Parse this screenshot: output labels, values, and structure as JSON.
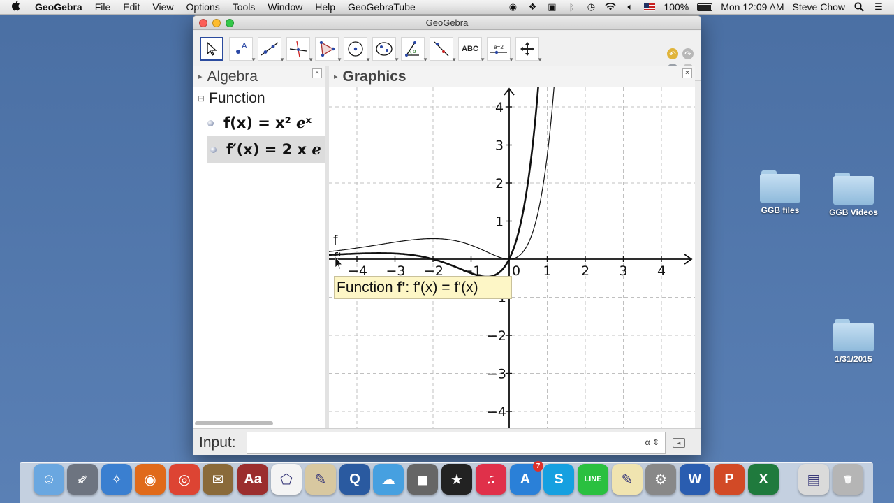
{
  "menubar": {
    "apple": "",
    "app_name": "GeoGebra",
    "items": [
      "File",
      "Edit",
      "View",
      "Options",
      "Tools",
      "Window",
      "Help",
      "GeoGebraTube"
    ],
    "battery": "100%",
    "clock": "Mon 12:09 AM",
    "user": "Steve Chow"
  },
  "window": {
    "title": "GeoGebra"
  },
  "toolbar": {
    "tools": [
      "move-tool",
      "point-tool",
      "line-tool",
      "perpendicular-tool",
      "polygon-tool",
      "circle-tool",
      "conic-tool",
      "angle-tool",
      "reflect-tool",
      "text-tool",
      "slider-tool",
      "move-graphics-tool"
    ],
    "text_tool_label": "ABC",
    "slider_tool_label": "a=2"
  },
  "algebra": {
    "title": "Algebra",
    "group": "Function",
    "items": [
      {
        "label": "f(x) = x² ℯˣ"
      },
      {
        "label": "f′(x) = 2 x ℯ"
      }
    ]
  },
  "graphics": {
    "title": "Graphics",
    "x_ticks": [
      "−4",
      "−3",
      "−2",
      "−1",
      "0",
      "1",
      "2",
      "3",
      "4"
    ],
    "y_ticks": [
      "4",
      "3",
      "2",
      "1",
      "−1",
      "−2",
      "−3",
      "−4"
    ],
    "label_f": "f",
    "label_fprime": "f'",
    "tooltip": {
      "prefix": "Function ",
      "name": "f'",
      "rest": ": f'(x) = f'(x)"
    }
  },
  "input": {
    "label": "Input:",
    "value": "",
    "alpha": "α ⇕"
  },
  "desktop": {
    "icons": [
      {
        "label": "GGB files"
      },
      {
        "label": "GGB Videos"
      },
      {
        "label": "1/31/2015"
      }
    ]
  },
  "dock": {
    "apps": [
      "Finder",
      "Launchpad",
      "Safari",
      "Firefox",
      "Chrome",
      "Mail",
      "Dictionary",
      "GeoGebra",
      "Pencil",
      "QuickTime",
      "Messages",
      "FaceTime",
      "iMovie",
      "iTunes",
      "App Store",
      "Skype",
      "LINE",
      "TextEdit",
      "System Preferences",
      "Word",
      "PowerPoint",
      "Excel",
      "Downloads",
      "Trash"
    ],
    "app_store_badge": "7"
  },
  "colors": {
    "desktop": "#4f74a8",
    "active_tool_border": "#2b4b9e",
    "tooltip_bg": "#fdf6c6"
  }
}
